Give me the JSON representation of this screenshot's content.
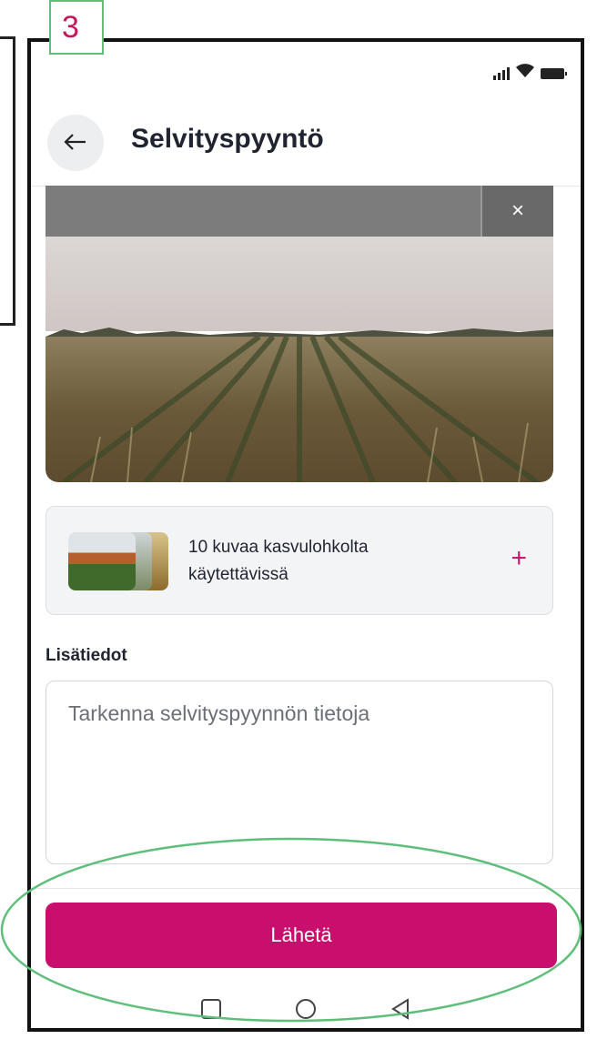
{
  "annotation": {
    "step_number": "3",
    "ellipse_color": "#5fbf7a"
  },
  "status_bar": {
    "icons": [
      "signal-icon",
      "wifi-icon",
      "battery-icon"
    ]
  },
  "header": {
    "title": "Selvityspyyntö",
    "back_icon": "arrow-left-icon"
  },
  "photo": {
    "close_label": "×"
  },
  "gallery": {
    "text_line1": "10 kuvaa kasvulohkolta",
    "text_line2": "käytettävissä",
    "add_label": "+"
  },
  "details": {
    "label": "Lisätiedot",
    "placeholder": "Tarkenna selvityspyynnön tietoja"
  },
  "actions": {
    "send_label": "Lähetä"
  },
  "colors": {
    "accent": "#c80f6e",
    "text": "#1f2430",
    "card_bg": "#f3f4f6"
  },
  "navbar": {
    "icons": [
      "square-icon",
      "circle-icon",
      "triangle-back-icon"
    ]
  }
}
